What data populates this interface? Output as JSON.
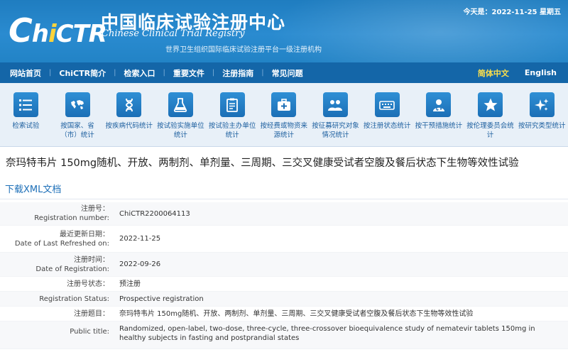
{
  "header": {
    "logo_text_c": "C",
    "logo_text_h": "h",
    "logo_text_i": "i",
    "logo_text_ctr": "CTR",
    "site_title_zh": "中国临床试验注册中心",
    "site_title_en": "Chinese Clinical Trial Registry",
    "site_subtitle": "世界卫生组织国际临床试验注册平台一级注册机构",
    "today": "今天是：2022-11-25 星期五"
  },
  "nav": {
    "items": [
      "网站首页",
      "ChiCTR简介",
      "检索入口",
      "重要文件",
      "注册指南",
      "常见问题"
    ],
    "separator": "|",
    "lang_zh": "简体中文",
    "lang_en": "English"
  },
  "icon_bar": {
    "items": [
      {
        "label": "检索试验",
        "icon": "list-icon"
      },
      {
        "label": "按国家、省（市）统计",
        "icon": "world-map-icon"
      },
      {
        "label": "按疾病代码统计",
        "icon": "dna-icon"
      },
      {
        "label": "按试验实施单位统计",
        "icon": "flask-icon"
      },
      {
        "label": "按试验主办单位统计",
        "icon": "clipboard-icon"
      },
      {
        "label": "按经费或物资来源统计",
        "icon": "medical-kit-icon"
      },
      {
        "label": "按征募研究对象情况统计",
        "icon": "people-icon"
      },
      {
        "label": "按注册状态统计",
        "icon": "keyboard-icon"
      },
      {
        "label": "按干预措施统计",
        "icon": "doctor-icon"
      },
      {
        "label": "按伦理委员会统计",
        "icon": "star-icon"
      },
      {
        "label": "按研究类型统计",
        "icon": "sparkle-icon"
      }
    ]
  },
  "trial": {
    "title": "奈玛特韦片 150mg随机、开放、两制剂、单剂量、三周期、三交叉健康受试者空腹及餐后状态下生物等效性试验",
    "xml_link": "下载XML文档",
    "fields": {
      "reg_no_zh": "注册号：",
      "reg_no_en": "Registration number:",
      "reg_no": "ChiCTR2200064113",
      "last_refreshed_zh": "最近更新日期：",
      "last_refreshed_en": "Date of Last Refreshed on:",
      "last_refreshed": "2022-11-25",
      "reg_time_zh": "注册时间：",
      "reg_time_en": "Date of Registration:",
      "reg_time": "2022-09-26",
      "status_zh": "注册号状态：",
      "status_zh_value": "预注册",
      "status_en": "Registration Status:",
      "status_en_value": "Prospective registration",
      "title_zh_label": "注册题目：",
      "title_zh_value": "奈玛特韦片 150mg随机、开放、两制剂、单剂量、三周期、三交叉健康受试者空腹及餐后状态下生物等效性试验",
      "public_title_label": "Public title:",
      "public_title_value": "Randomized, open-label, two-dose, three-cycle, three-crossover bioequivalence study of nematevir tablets 150mg in healthy subjects in fasting and postprandial states"
    }
  }
}
